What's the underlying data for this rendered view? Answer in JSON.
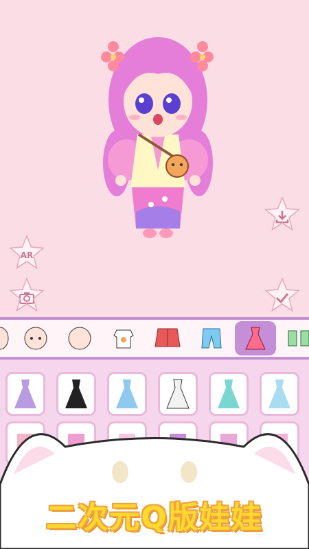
{
  "app": {
    "buttons": {
      "ar_label": "AR",
      "camera_icon": "camera-icon",
      "save_icon": "download-icon",
      "confirm_icon": "check-icon"
    },
    "categories": [
      {
        "name": "face-a",
        "icon": "face-icon"
      },
      {
        "name": "face-b",
        "icon": "face-icon"
      },
      {
        "name": "face-c",
        "icon": "face-icon"
      },
      {
        "name": "top",
        "icon": "shirt-icon"
      },
      {
        "name": "jacket",
        "icon": "jacket-icon"
      },
      {
        "name": "pants",
        "icon": "pants-icon"
      },
      {
        "name": "dress",
        "icon": "dress-icon",
        "selected": true
      },
      {
        "name": "socks",
        "icon": "socks-icon"
      }
    ],
    "slogan": "二次元Q版娃娃"
  }
}
